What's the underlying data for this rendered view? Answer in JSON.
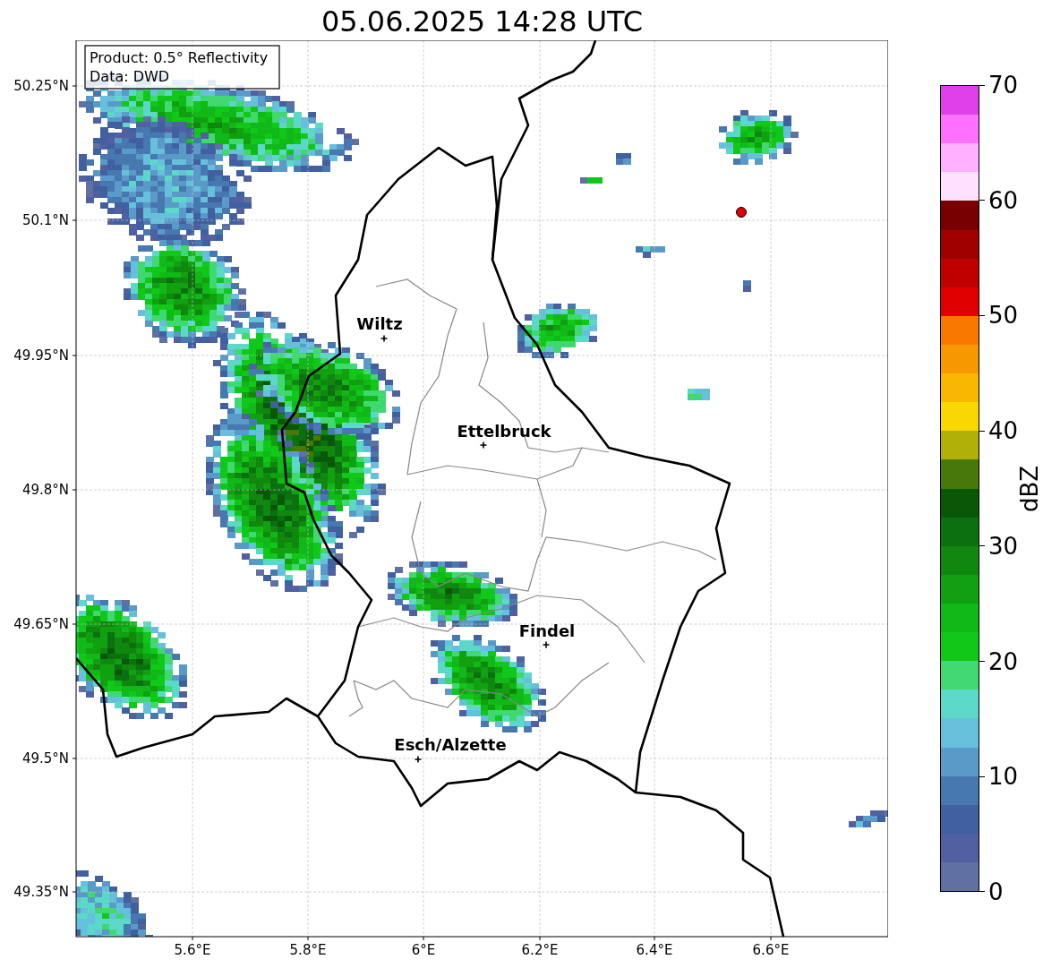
{
  "title": "05.06.2025 14:28 UTC",
  "info_box": {
    "lines": [
      "Product: 0.5° Reflectivity",
      "Data: DWD"
    ]
  },
  "map": {
    "y_ticks": [
      "50.25°N",
      "50.1°N",
      "49.95°N",
      "49.8°N",
      "49.65°N",
      "49.5°N",
      "49.35°N"
    ],
    "x_ticks": [
      "5.6°E",
      "5.8°E",
      "6°E",
      "6.2°E",
      "6.4°E",
      "6.6°E"
    ],
    "cities": [
      {
        "name": "Wiltz"
      },
      {
        "name": "Ettelbruck"
      },
      {
        "name": "Findel"
      },
      {
        "name": "Esch/Alzette"
      }
    ]
  },
  "colorbar": {
    "label": "dBZ",
    "ticks": [
      "70",
      "60",
      "50",
      "40",
      "30",
      "20",
      "10",
      "0"
    ],
    "bins": [
      {
        "color": "#6070a0"
      },
      {
        "color": "#5060a0"
      },
      {
        "color": "#4060a0"
      },
      {
        "color": "#4878b0"
      },
      {
        "color": "#5a9ac8"
      },
      {
        "color": "#66c0dc"
      },
      {
        "color": "#5cd8c8"
      },
      {
        "color": "#40d870"
      },
      {
        "color": "#10c818"
      },
      {
        "color": "#10b818"
      },
      {
        "color": "#10a010"
      },
      {
        "color": "#108810"
      },
      {
        "color": "#0a7010"
      },
      {
        "color": "#085808"
      },
      {
        "color": "#487808"
      },
      {
        "color": "#b0b008"
      },
      {
        "color": "#f8d800"
      },
      {
        "color": "#f8b800"
      },
      {
        "color": "#f89800"
      },
      {
        "color": "#f87800"
      },
      {
        "color": "#e00000"
      },
      {
        "color": "#c00000"
      },
      {
        "color": "#a00000"
      },
      {
        "color": "#780000"
      },
      {
        "color": "#ffe0ff"
      },
      {
        "color": "#ffb0ff"
      },
      {
        "color": "#ff70ff"
      },
      {
        "color": "#e040e8"
      }
    ]
  }
}
